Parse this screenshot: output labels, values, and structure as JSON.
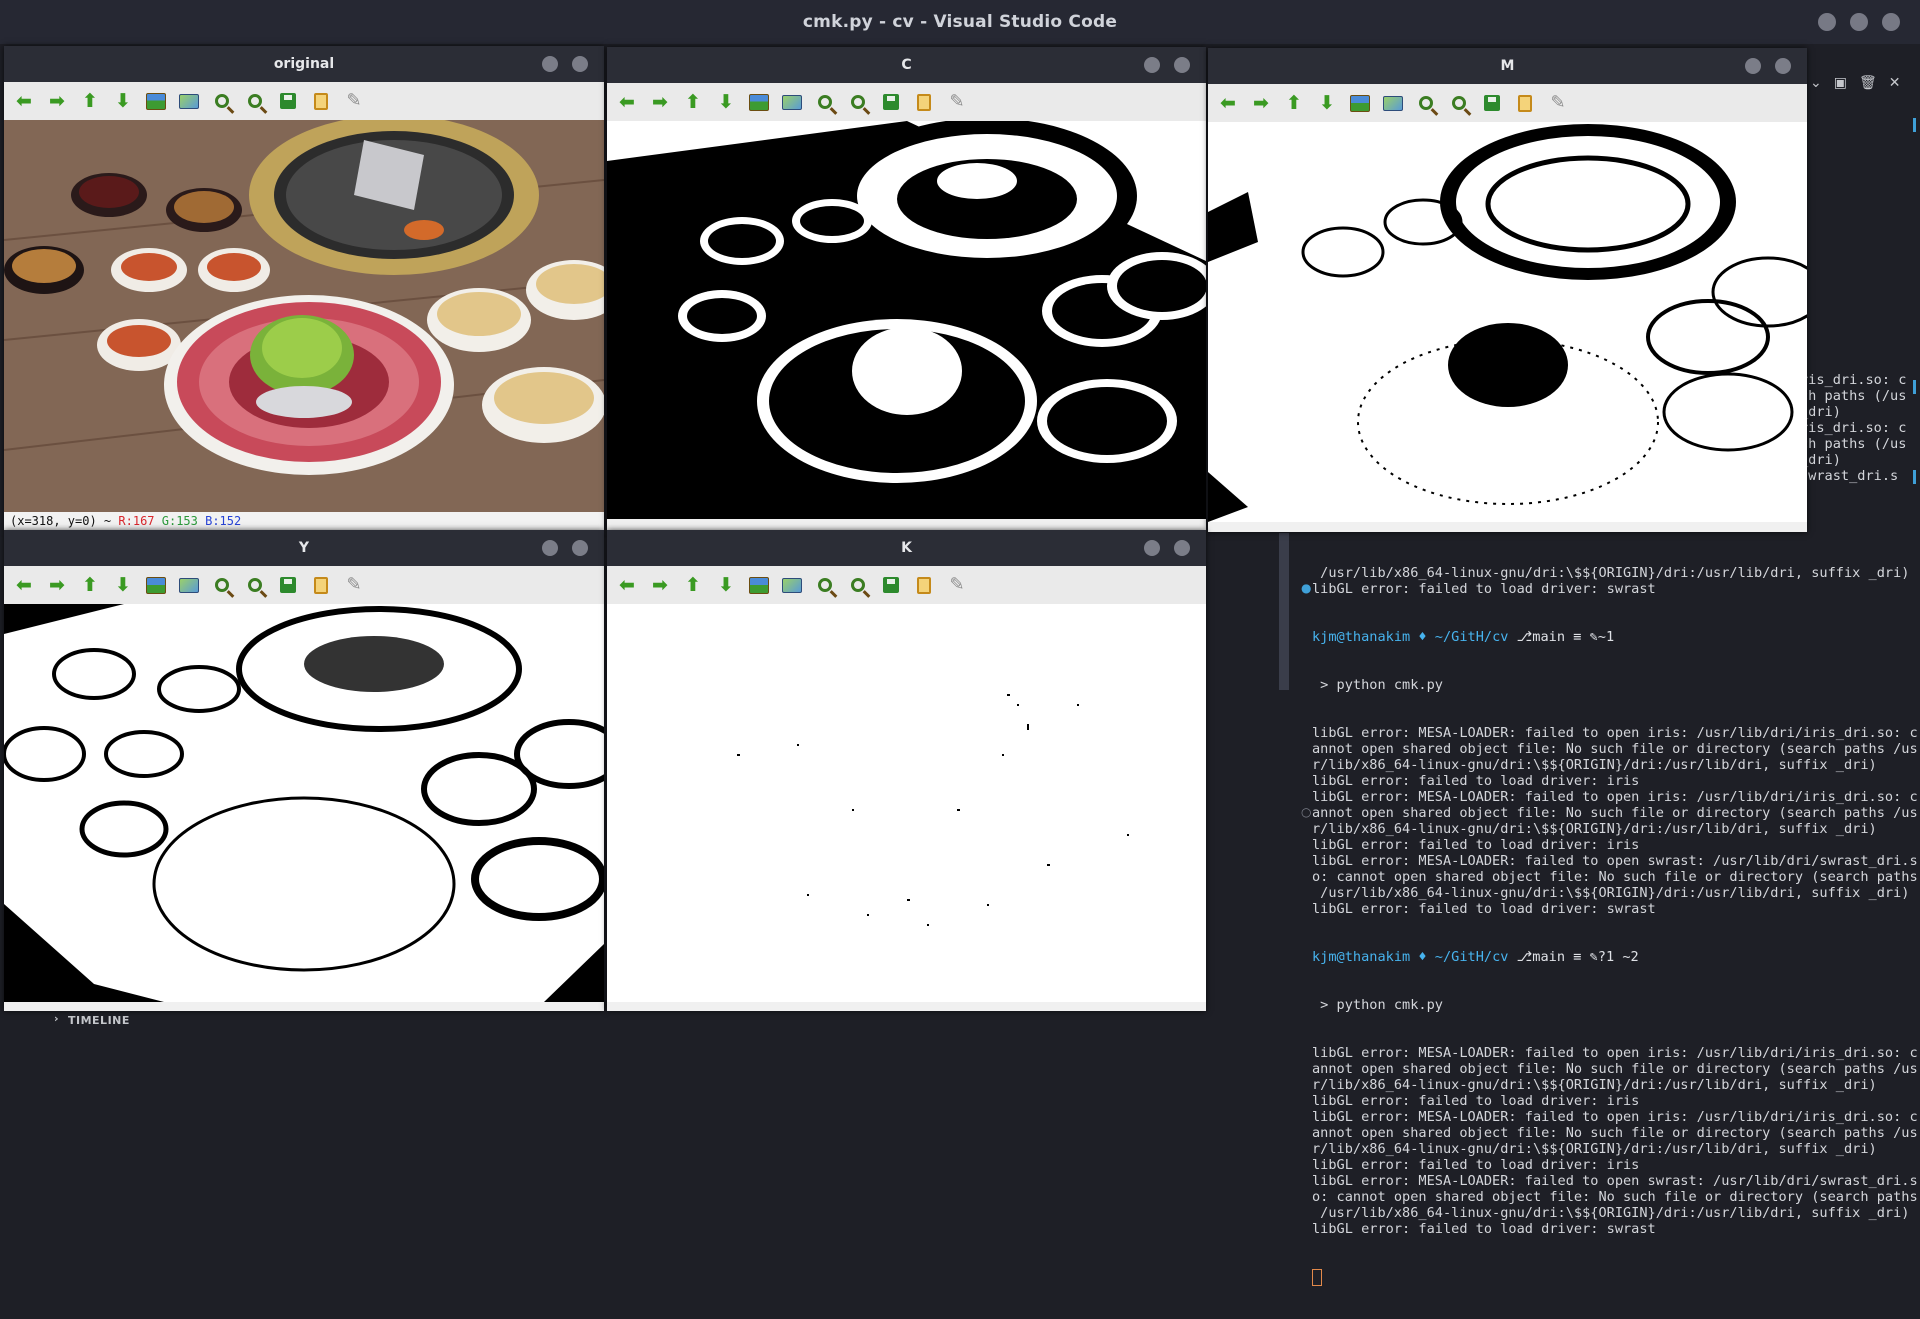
{
  "app": {
    "title": "cmk.py - cv - Visual Studio Code",
    "timeline_label": "TIMELINE"
  },
  "windows": [
    {
      "key": "original",
      "title": "original"
    },
    {
      "key": "C",
      "title": "C"
    },
    {
      "key": "M",
      "title": "M"
    },
    {
      "key": "Y",
      "title": "Y"
    },
    {
      "key": "K",
      "title": "K"
    }
  ],
  "toolbar_icons": [
    "arrow-left-icon",
    "arrow-right-icon",
    "arrow-up-icon",
    "arrow-down-icon",
    "image-icon",
    "image-properties-icon",
    "zoom-in-icon",
    "zoom-out-icon",
    "save-icon",
    "copy-icon",
    "brush-icon"
  ],
  "original_status": {
    "coords": "(x=318, y=0) ~",
    "r": "R:167",
    "g": "G:153",
    "b": "B:152"
  },
  "terminal": {
    "partial": [
      "ris_dri.so: c",
      "ch paths (/us",
      "_dri)",
      "",
      "ris_dri.so: c",
      "ch paths (/us",
      "_dri)",
      "",
      "swrast_dri.s"
    ],
    "top_lines": [
      " /usr/lib/x86_64-linux-gnu/dri:\\$${ORIGIN}/dri:/usr/lib/dri, suffix _dri)",
      "libGL error: failed to load driver: swrast"
    ],
    "prompt1": {
      "user": "kjm@thanakim",
      "path": " ~/GitH/cv ",
      "branch": "main ≡ ✎~1"
    },
    "cmd1": " > python cmk.py",
    "block1": [
      "libGL error: MESA-LOADER: failed to open iris: /usr/lib/dri/iris_dri.so: c",
      "annot open shared object file: No such file or directory (search paths /us",
      "r/lib/x86_64-linux-gnu/dri:\\$${ORIGIN}/dri:/usr/lib/dri, suffix _dri)",
      "libGL error: failed to load driver: iris",
      "libGL error: MESA-LOADER: failed to open iris: /usr/lib/dri/iris_dri.so: c",
      "annot open shared object file: No such file or directory (search paths /us",
      "r/lib/x86_64-linux-gnu/dri:\\$${ORIGIN}/dri:/usr/lib/dri, suffix _dri)",
      "libGL error: failed to load driver: iris",
      "libGL error: MESA-LOADER: failed to open swrast: /usr/lib/dri/swrast_dri.s",
      "o: cannot open shared object file: No such file or directory (search paths",
      " /usr/lib/x86_64-linux-gnu/dri:\\$${ORIGIN}/dri:/usr/lib/dri, suffix _dri)",
      "libGL error: failed to load driver: swrast"
    ],
    "prompt2": {
      "user": "kjm@thanakim",
      "path": " ~/GitH/cv ",
      "branch": "main ≡ ✎?1 ~2"
    },
    "cmd2": " > python cmk.py",
    "block2": [
      "libGL error: MESA-LOADER: failed to open iris: /usr/lib/dri/iris_dri.so: c",
      "annot open shared object file: No such file or directory (search paths /us",
      "r/lib/x86_64-linux-gnu/dri:\\$${ORIGIN}/dri:/usr/lib/dri, suffix _dri)",
      "libGL error: failed to load driver: iris",
      "libGL error: MESA-LOADER: failed to open iris: /usr/lib/dri/iris_dri.so: c",
      "annot open shared object file: No such file or directory (search paths /us",
      "r/lib/x86_64-linux-gnu/dri:\\$${ORIGIN}/dri:/usr/lib/dri, suffix _dri)",
      "libGL error: failed to load driver: iris",
      "libGL error: MESA-LOADER: failed to open swrast: /usr/lib/dri/swrast_dri.s",
      "o: cannot open shared object file: No such file or directory (search paths",
      " /usr/lib/x86_64-linux-gnu/dri:\\$${ORIGIN}/dri:/usr/lib/dri, suffix _dri)",
      "libGL error: failed to load driver: swrast"
    ]
  }
}
